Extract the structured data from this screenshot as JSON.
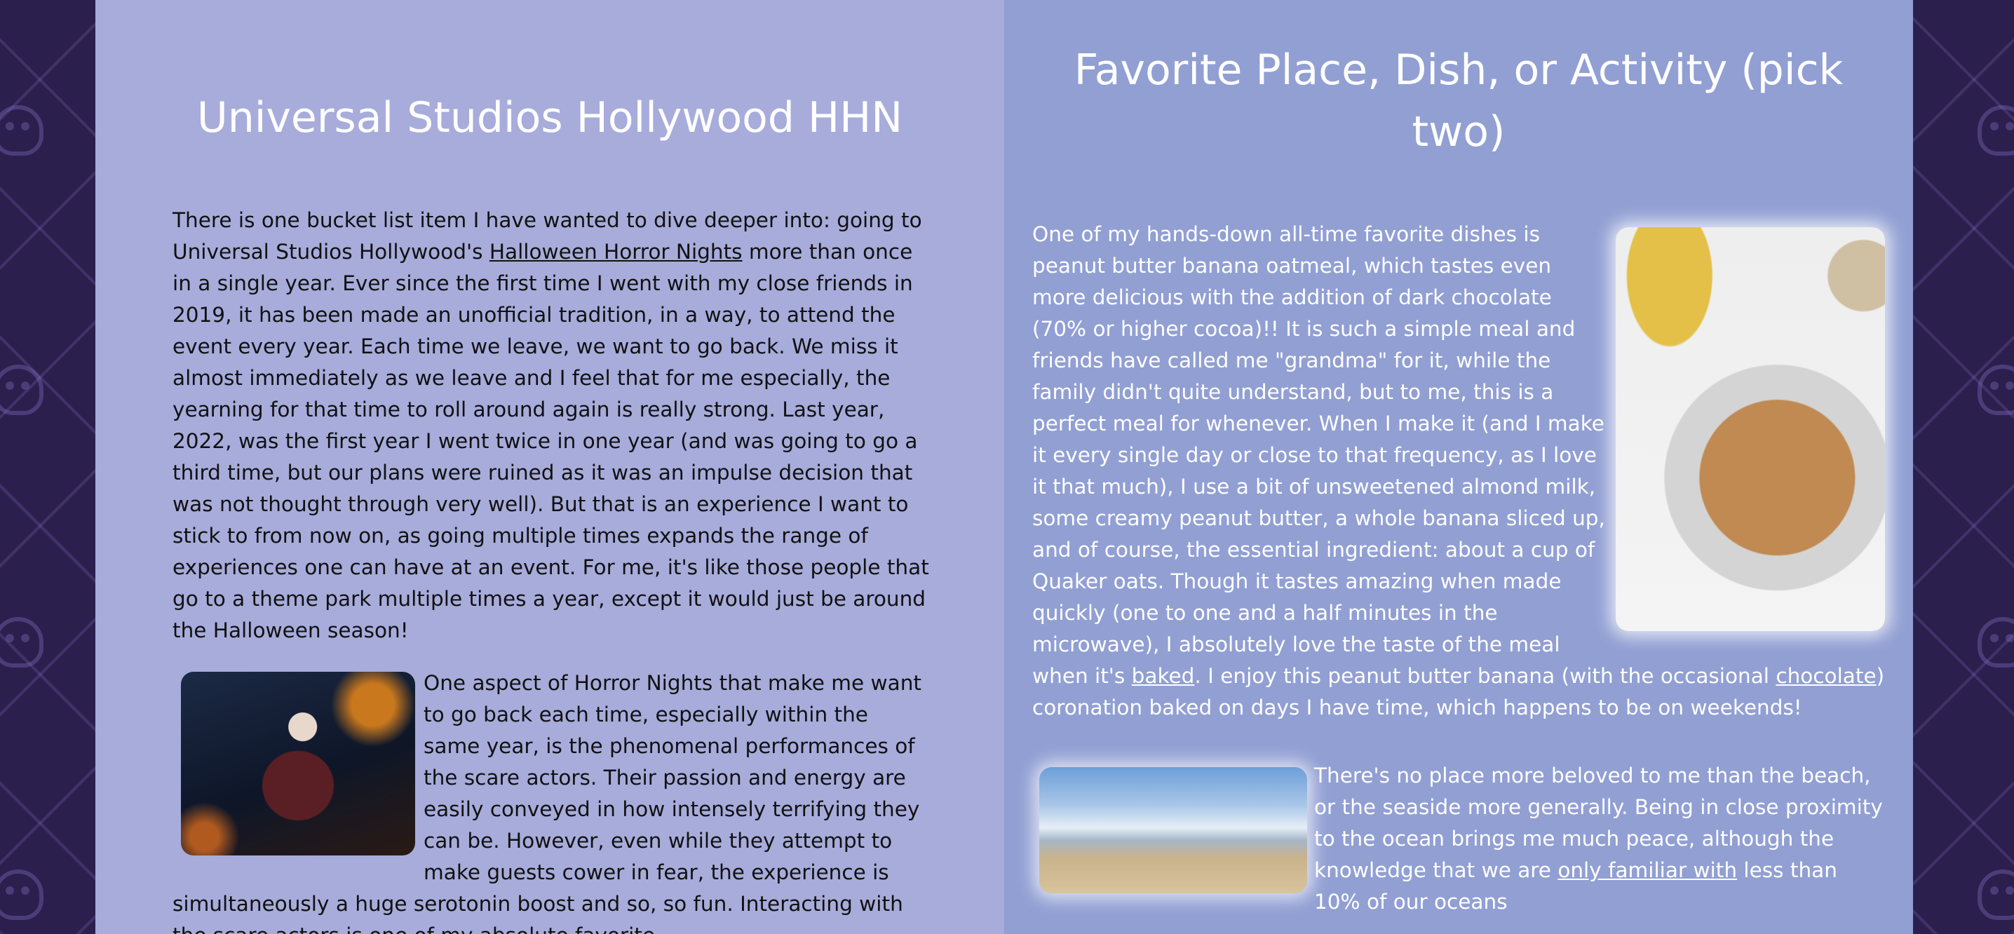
{
  "left_section": {
    "title": "Universal Studios Hollywood HHN",
    "para1_before_link": "There is one bucket list item I have wanted to dive deeper into: going to Universal Studios Hollywood's ",
    "para1_link": "Halloween Horror Nights",
    "para1_after_link": " more than once in a single year. Ever since the first time I went with my close friends in 2019, it has been made an unofficial tradition, in a way, to attend the event every year. Each time we leave, we want to go back. We miss it almost immediately as we leave and I feel that for me especially, the yearning for that time to roll around again is really strong. Last year, 2022, was the first year I went twice in one year (and was going to go a third time, but our plans were ruined as it was an impulse decision that was not thought through very well). But that is an experience I want to stick to from now on, as going multiple times expands the range of experiences one can have at an event. For me, it's like those people that go to a theme park multiple times a year, except it would just be around the Halloween season!",
    "para2": "One aspect of Horror Nights that make me want to go back each time, especially within the same year, is the phenomenal performances of the scare actors. Their passion and energy are easily conveyed in how intensely terrifying they can be. However, even while they attempt to make guests cower in fear, the experience is simultaneously a huge serotonin boost and so, so fun. Interacting with the scare actors is one of my absolute favorite"
  },
  "right_section": {
    "title": "Favorite Place, Dish, or Activity (pick two)",
    "para1_before_baked": "One of my hands-down all-time favorite dishes is peanut butter banana oatmeal, which tastes even more delicious with the addition of dark chocolate (70% or higher cocoa)!! It is such a simple meal and friends have called me \"grandma\" for it, while the family didn't quite understand, but to me, this is a perfect meal for whenever. When I make it (and I make it every single day or close to that frequency, as I love it that much), I use a bit of unsweetened almond milk, some creamy peanut butter, a whole banana sliced up, and of course, the essential ingredient: about a cup of Quaker oats. Though it tastes amazing when made quickly (one to one and a half minutes in the microwave), I absolutely love the taste of the meal when it's ",
    "link_baked": "baked",
    "para1_middle": ". I enjoy this peanut butter banana (with the occasional ",
    "link_chocolate": "chocolate",
    "para1_end": ") coronation baked on days I have time, which happens to be on weekends!",
    "para2_before_link": "There's no place more beloved to me than the beach, or the seaside more generally. Being in close proximity to the ocean brings me much peace, although the knowledge that we are ",
    "para2_link": "only familiar with",
    "para2_after_link": " less than 10% of our oceans"
  }
}
